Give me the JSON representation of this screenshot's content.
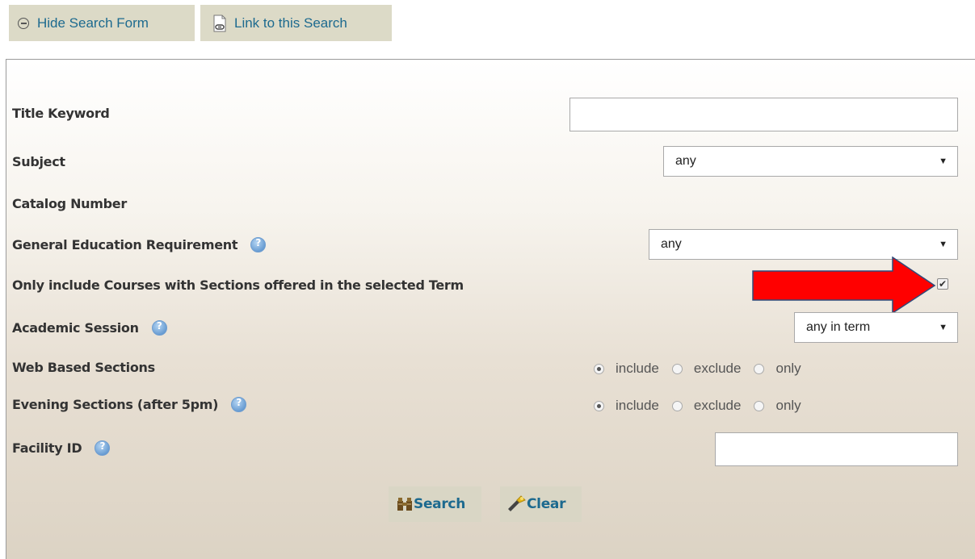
{
  "toolbar": {
    "hide_search_form": "Hide Search Form",
    "link_to_search": "Link to this Search"
  },
  "form": {
    "title_keyword": {
      "label": "Title Keyword",
      "value": ""
    },
    "subject": {
      "label": "Subject",
      "value": "any"
    },
    "catalog_number": {
      "label": "Catalog Number"
    },
    "gen_ed": {
      "label": "General Education Requirement",
      "value": "any"
    },
    "only_offered": {
      "label": "Only include Courses with Sections offered in the selected Term",
      "checked": true
    },
    "academic_session": {
      "label": "Academic Session",
      "value": "any in term"
    },
    "web_based": {
      "label": "Web Based Sections",
      "selected": "include"
    },
    "evening": {
      "label": "Evening Sections (after 5pm)",
      "selected": "include"
    },
    "facility_id": {
      "label": "Facility ID",
      "value": ""
    },
    "radio_options": {
      "include": "include",
      "exclude": "exclude",
      "only": "only"
    }
  },
  "actions": {
    "search": "Search",
    "clear": "Clear"
  },
  "icons": {
    "hide": "minus-circle-icon",
    "link": "document-link-icon",
    "help": "help-icon",
    "search": "binoculars-icon",
    "clear": "eraser-icon",
    "annotation": "red-arrow"
  },
  "colors": {
    "link_text": "#1d6a8f",
    "button_bg": "#dcdac7",
    "arrow": "#ff0000"
  }
}
